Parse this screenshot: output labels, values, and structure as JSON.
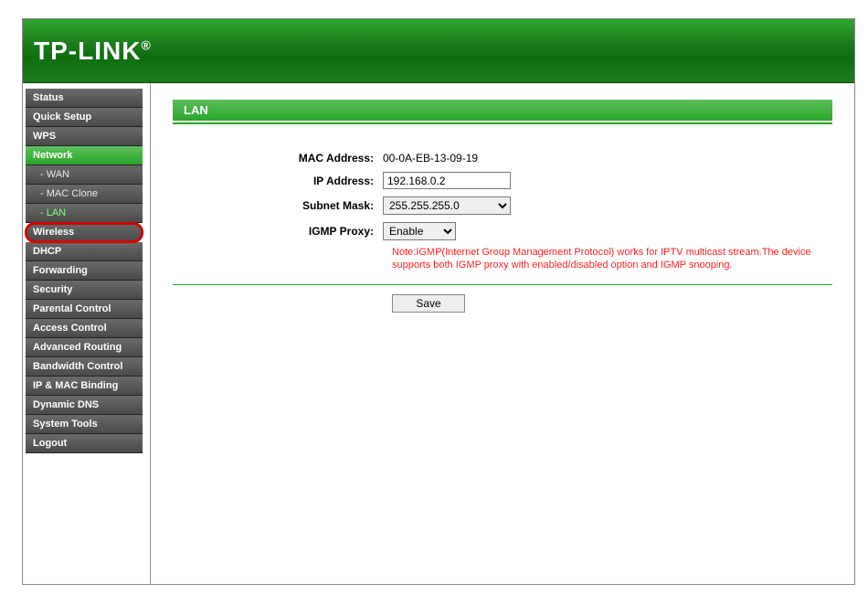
{
  "header": {
    "brand": "TP-LINK"
  },
  "sidebar": {
    "items": [
      {
        "label": "Status",
        "name": "sidebar-item-status"
      },
      {
        "label": "Quick Setup",
        "name": "sidebar-item-quick-setup"
      },
      {
        "label": "WPS",
        "name": "sidebar-item-wps"
      },
      {
        "label": "Network",
        "name": "sidebar-item-network",
        "active": true
      },
      {
        "label": "- WAN",
        "name": "sidebar-item-wan",
        "sub": true
      },
      {
        "label": "- MAC Clone",
        "name": "sidebar-item-mac-clone",
        "sub": true
      },
      {
        "label": "- LAN",
        "name": "sidebar-item-lan",
        "sub": true,
        "current": true
      },
      {
        "label": "Wireless",
        "name": "sidebar-item-wireless",
        "highlighted": true
      },
      {
        "label": "DHCP",
        "name": "sidebar-item-dhcp"
      },
      {
        "label": "Forwarding",
        "name": "sidebar-item-forwarding"
      },
      {
        "label": "Security",
        "name": "sidebar-item-security"
      },
      {
        "label": "Parental Control",
        "name": "sidebar-item-parental-control"
      },
      {
        "label": "Access Control",
        "name": "sidebar-item-access-control"
      },
      {
        "label": "Advanced Routing",
        "name": "sidebar-item-advanced-routing"
      },
      {
        "label": "Bandwidth Control",
        "name": "sidebar-item-bandwidth-control"
      },
      {
        "label": "IP & MAC Binding",
        "name": "sidebar-item-ip-mac-binding"
      },
      {
        "label": "Dynamic DNS",
        "name": "sidebar-item-dynamic-dns"
      },
      {
        "label": "System Tools",
        "name": "sidebar-item-system-tools"
      },
      {
        "label": "Logout",
        "name": "sidebar-item-logout"
      }
    ]
  },
  "page": {
    "title": "LAN",
    "mac_label": "MAC Address:",
    "mac_value": "00-0A-EB-13-09-19",
    "ip_label": "IP Address:",
    "ip_value": "192.168.0.2",
    "subnet_label": "Subnet Mask:",
    "subnet_value": "255.255.255.0",
    "igmp_label": "IGMP Proxy:",
    "igmp_value": "Enable",
    "note": "Note:IGMP(Internet Group Management Protocol) works for IPTV multicast stream.The device supports both IGMP proxy with enabled/disabled option and IGMP snooping.",
    "save_label": "Save"
  }
}
